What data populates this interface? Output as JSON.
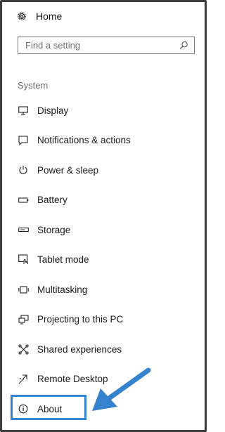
{
  "home": {
    "label": "Home",
    "icon": "gear-icon"
  },
  "search": {
    "placeholder": "Find a setting",
    "value": "",
    "icon": "search-icon"
  },
  "section_title": "System",
  "items": [
    {
      "label": "Display",
      "icon": "display-icon"
    },
    {
      "label": "Notifications & actions",
      "icon": "notifications-icon"
    },
    {
      "label": "Power & sleep",
      "icon": "power-icon"
    },
    {
      "label": "Battery",
      "icon": "battery-icon"
    },
    {
      "label": "Storage",
      "icon": "storage-icon"
    },
    {
      "label": "Tablet mode",
      "icon": "tablet-mode-icon"
    },
    {
      "label": "Multitasking",
      "icon": "multitasking-icon"
    },
    {
      "label": "Projecting to this PC",
      "icon": "projecting-icon"
    },
    {
      "label": "Shared experiences",
      "icon": "shared-experiences-icon"
    },
    {
      "label": "Remote Desktop",
      "icon": "remote-desktop-icon"
    },
    {
      "label": "About",
      "icon": "info-icon",
      "selected": true
    }
  ],
  "colors": {
    "highlight": "#3582cf",
    "frame": "#3c3c3c",
    "arrow": "#3582cf"
  }
}
